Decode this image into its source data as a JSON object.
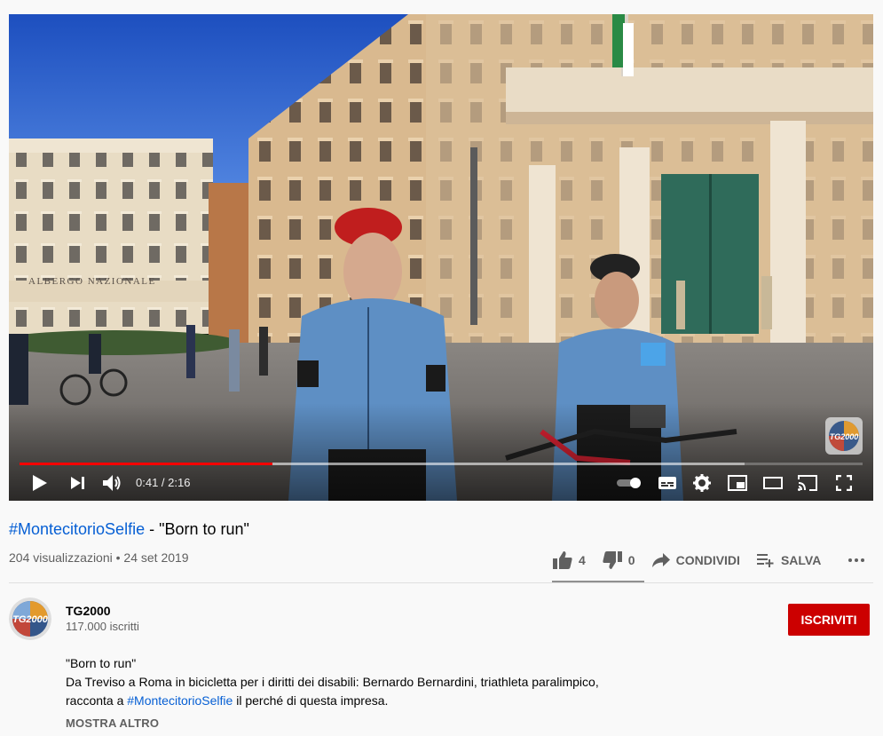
{
  "player": {
    "time_current": "0:41",
    "time_total": "2:16",
    "time_display": "0:41 / 2:16",
    "progress_played_fraction": 0.3,
    "progress_loaded_fraction": 0.86,
    "building_sign": "ALBERGO NAZIONALE",
    "watermark_text": "TG2000",
    "controls": [
      "play-icon",
      "next-icon",
      "volume-icon",
      "autoplay-toggle-icon",
      "subtitles-icon",
      "settings-icon",
      "miniplayer-icon",
      "theater-icon",
      "cast-icon",
      "fullscreen-icon"
    ]
  },
  "video": {
    "title_hashtag": "#MontecitorioSelfie",
    "title_rest": " - \"Born to run\"",
    "views_date": "204 visualizzazioni • 24 set 2019",
    "likes": "4",
    "dislikes": "0",
    "share_label": "CONDIVIDI",
    "save_label": "SALVA",
    "more_icon": "more-horizontal-icon",
    "like_fraction": 1.0
  },
  "channel": {
    "name": "TG2000",
    "subscribers": "117.000 iscritti",
    "avatar_text": "TG2000",
    "subscribe_label": "ISCRIVITI"
  },
  "description": {
    "line1": "\"Born to run\"",
    "line2": "Da Treviso a Roma in bicicletta per i diritti dei disabili: Bernardo Bernardini, triathleta paralimpico,",
    "line3_prefix": "racconta a ",
    "line3_hashtag": "#MontecitorioSelfie",
    "line3_suffix": " il perché di questa impresa.",
    "show_more_label": "MOSTRA ALTRO"
  },
  "colors": {
    "accent_red": "#cc0000",
    "progress_red": "#ff0000",
    "link_blue": "#065fd4",
    "muted_text": "#606060"
  }
}
